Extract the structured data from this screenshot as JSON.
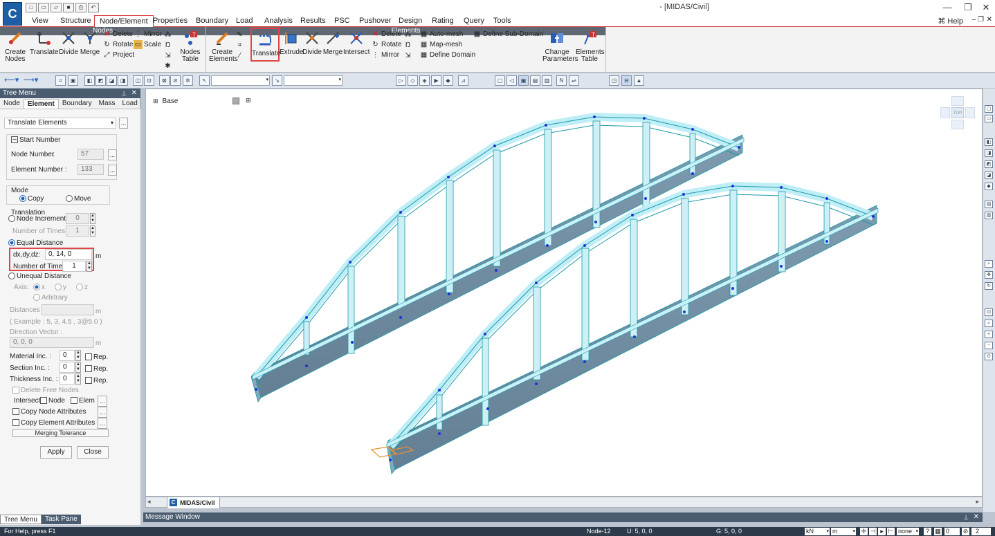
{
  "window": {
    "title": "- [MIDAS/Civil]",
    "app_icon": "C"
  },
  "quick_access": {
    "icons": [
      "new-icon",
      "open-icon",
      "open-folder-icon",
      "save-icon",
      "print-icon",
      "undo-icon"
    ]
  },
  "menu": {
    "items": [
      "View",
      "Structure",
      "Node/Element",
      "Properties",
      "Boundary",
      "Load",
      "Analysis",
      "Results",
      "PSC",
      "Pushover",
      "Design",
      "Rating",
      "Query",
      "Tools"
    ],
    "active": "Node/Element",
    "help": "Help"
  },
  "ribbon": {
    "nodes_group": {
      "name": "Nodes",
      "create": "Create\nNodes",
      "translate": "Translate",
      "divide": "Divide",
      "merge": "Merge",
      "delete": "Delete",
      "rotate": "Rotate",
      "project": "Project",
      "mirror": "Mirror",
      "scale": "Scale",
      "table": "Nodes\nTable"
    },
    "elements_group": {
      "name": "Elements",
      "create": "Create\nElements",
      "translate": "Translate",
      "extrude": "Extrude",
      "divide": "Divide",
      "merge": "Merge",
      "intersect": "Intersect",
      "delete": "Delete",
      "rotate": "Rotate",
      "mirror": "Mirror",
      "auto_mesh": "Auto-mesh",
      "map_mesh": "Map-mesh",
      "define_domain": "Define Domain",
      "define_sub_domain": "Define Sub-Domain",
      "change_params": "Change\nParameters",
      "table": "Elements\nTable"
    }
  },
  "tree_menu": {
    "title": "Tree Menu",
    "tabs": [
      "Node",
      "Element",
      "Boundary",
      "Mass",
      "Load"
    ],
    "active_tab": "Element",
    "command": "Translate Elements",
    "start_number": {
      "label": "Start Number",
      "node_label": "Node Number",
      "node_value": "57",
      "elem_label": "Element Number",
      "elem_value": "133",
      "colon": ":"
    },
    "mode": {
      "label": "Mode",
      "copy": "Copy",
      "move": "Move",
      "selected": "Copy"
    },
    "translation": {
      "label": "Translation",
      "node_increment": "Node Increment",
      "node_increment_value": "0",
      "number_of_times_label": "Number of Times",
      "number_of_times_disabled": "1",
      "equal_distance": "Equal Distance",
      "dxdydz_label": "dx,dy,dz:",
      "dxdydz_value": "0, 14, 0",
      "unit": "m",
      "times_label": "Number of Times :",
      "times_value": "1",
      "unequal_distance": "Unequal Distance",
      "axis_label": "Axis:",
      "axis_x": "x",
      "axis_y": "y",
      "axis_z": "z",
      "arbitrary": "Arbitrary",
      "distances_label": "Distances :",
      "example": "( Example :  5, 3, 4.5 , 3@5.0 )",
      "direction_vector_label": "Direction Vector :",
      "direction_vector_value": "0, 0, 0"
    },
    "material_inc": {
      "label": "Material Inc.",
      "value": "0",
      "rep": "Rep."
    },
    "section_inc": {
      "label": "Section Inc.",
      "value": "0",
      "rep": "Rep."
    },
    "thickness_inc": {
      "label": "Thickness Inc.",
      "value": "0",
      "rep": "Rep."
    },
    "delete_free_nodes": "Delete Free Nodes",
    "intersect": {
      "label": "Intersect",
      "node": "Node",
      "elem": "Elem"
    },
    "copy_node_attr": "Copy Node Attributes",
    "copy_elem_attr": "Copy Element Attributes",
    "merging_tolerance": "Merging Tolerance",
    "apply": "Apply",
    "close": "Close",
    "ellipsis": "..."
  },
  "viewport": {
    "base_label": "Base",
    "tab_label": "MIDAS/Civil",
    "cube_label": "TOP"
  },
  "bottom_tabs": [
    "Tree Menu",
    "Task Pane"
  ],
  "message_window": {
    "title": "Message Window"
  },
  "status": {
    "help": "For Help, press F1",
    "node": "Node-12",
    "u": "U: 5, 0, 0",
    "g": "G: 5, 0, 0",
    "force_unit": "kN",
    "length_unit": "m",
    "none": "none",
    "zero": "0",
    "page": "2"
  },
  "colors": {
    "accent": "#d73b3b",
    "truss_top": "#bfeef7",
    "truss_side": "#6f8fa6",
    "node_dot": "#1f32d6",
    "dark_bar": "#4a5c70"
  }
}
